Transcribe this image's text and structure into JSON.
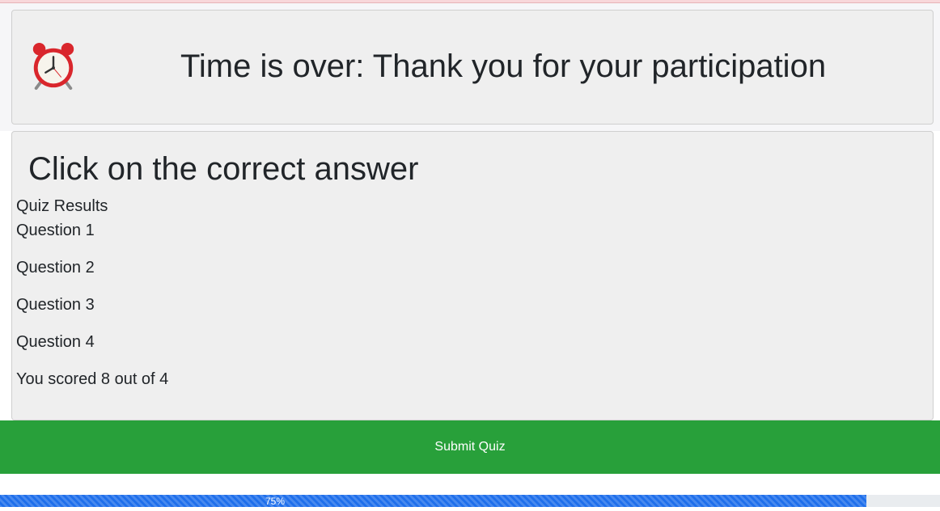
{
  "header": {
    "icon": "alarm-clock-icon",
    "title": "Time is over: Thank you for your participation"
  },
  "quiz": {
    "heading": "Click on the correct answer",
    "results_label": "Quiz Results",
    "questions": [
      "Question 1",
      "Question 2",
      "Question 3",
      "Question 4"
    ],
    "score_text": "You scored 8 out of 4"
  },
  "submit": {
    "label": "Submit Quiz",
    "color": "#28a03a"
  },
  "progress": {
    "label": "75%",
    "value": 0.922,
    "color": "#1f6feb"
  }
}
